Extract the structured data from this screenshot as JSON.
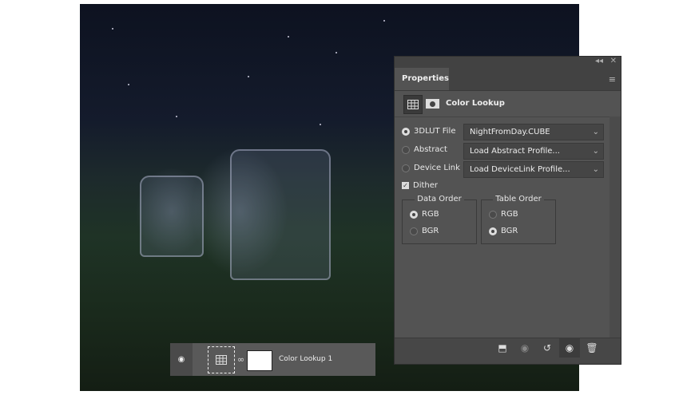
{
  "panel": {
    "tab": "Properties",
    "title": "Color Lookup",
    "options": [
      {
        "label": "3DLUT File",
        "value": "NightFromDay.CUBE",
        "selected": true
      },
      {
        "label": "Abstract",
        "value": "Load Abstract Profile...",
        "selected": false
      },
      {
        "label": "Device Link",
        "value": "Load DeviceLink Profile...",
        "selected": false
      }
    ],
    "dither": {
      "label": "Dither",
      "checked": true
    },
    "data_order": {
      "title": "Data Order",
      "rgb": "RGB",
      "bgr": "BGR",
      "selected": "RGB"
    },
    "table_order": {
      "title": "Table Order",
      "rgb": "RGB",
      "bgr": "BGR",
      "selected": "BGR"
    }
  },
  "layer": {
    "name": "Color Lookup 1"
  }
}
